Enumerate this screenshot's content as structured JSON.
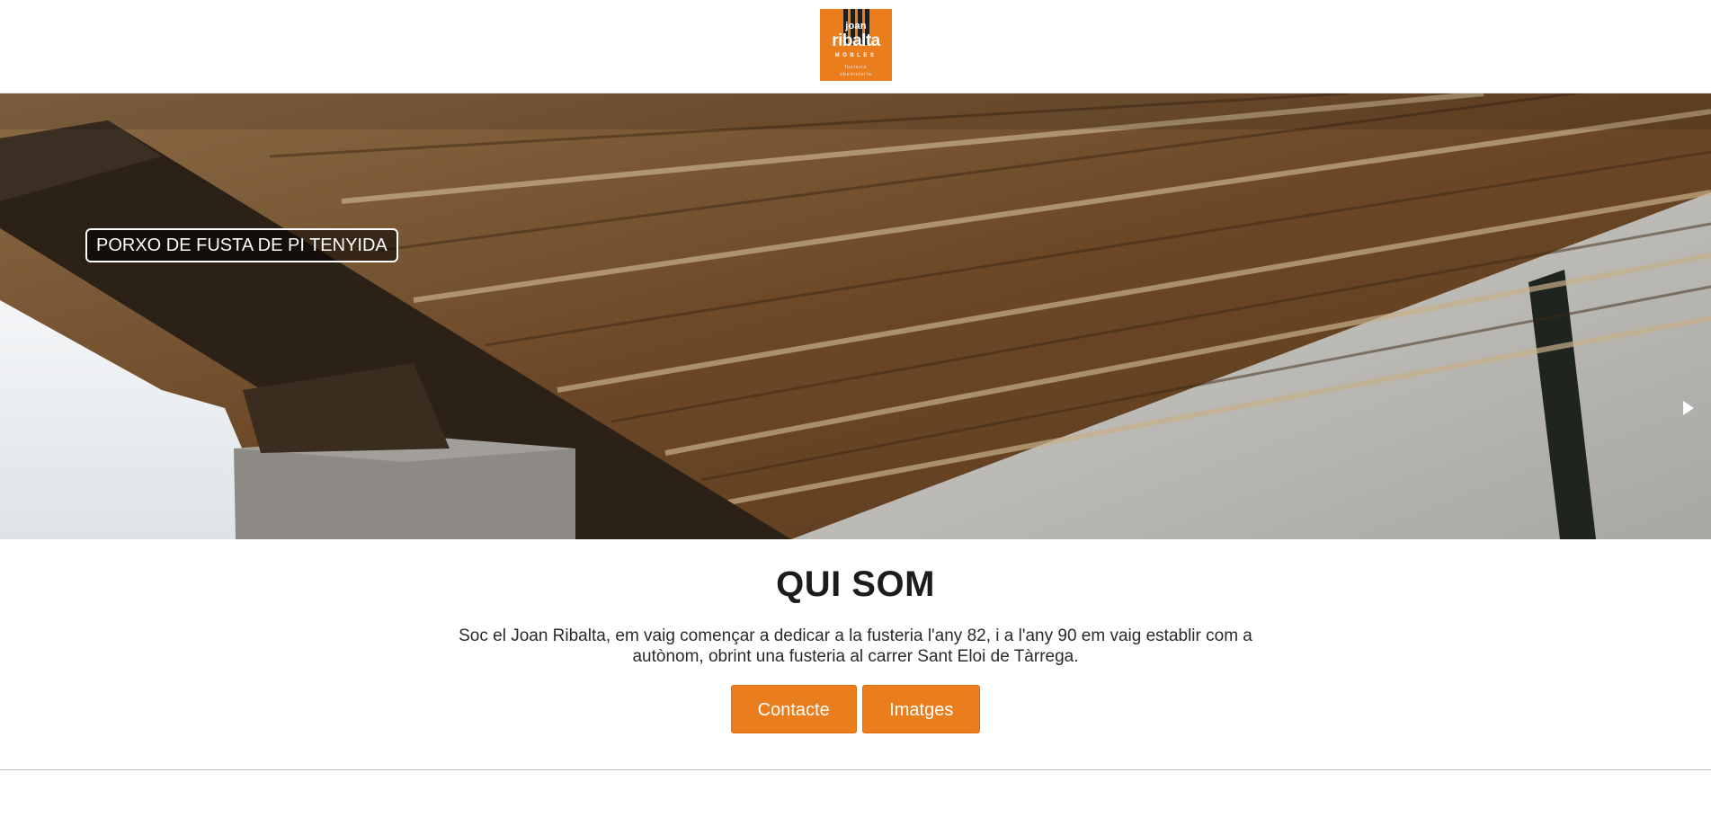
{
  "header": {
    "logo": {
      "line1": "joan",
      "line2": "ribalta",
      "line3": "MOBLES",
      "line4": "fusteria",
      "line5": "ebenisteria",
      "color": "#ea7d1c"
    }
  },
  "hero": {
    "caption": "PORXO DE FUSTA DE PI TENYIDA",
    "next_icon": "play-arrow-icon"
  },
  "about": {
    "title": "QUI SOM",
    "text": "Soc el Joan Ribalta, em vaig començar a dedicar a la fusteria l'any 82, i a l'any 90 em vaig establir com a autònom, obrint una fusteria al carrer Sant Eloi de Tàrrega.",
    "buttons": {
      "contact": "Contacte",
      "images": "Imatges"
    }
  },
  "colors": {
    "accent": "#ea7d1c",
    "text": "#222222"
  }
}
